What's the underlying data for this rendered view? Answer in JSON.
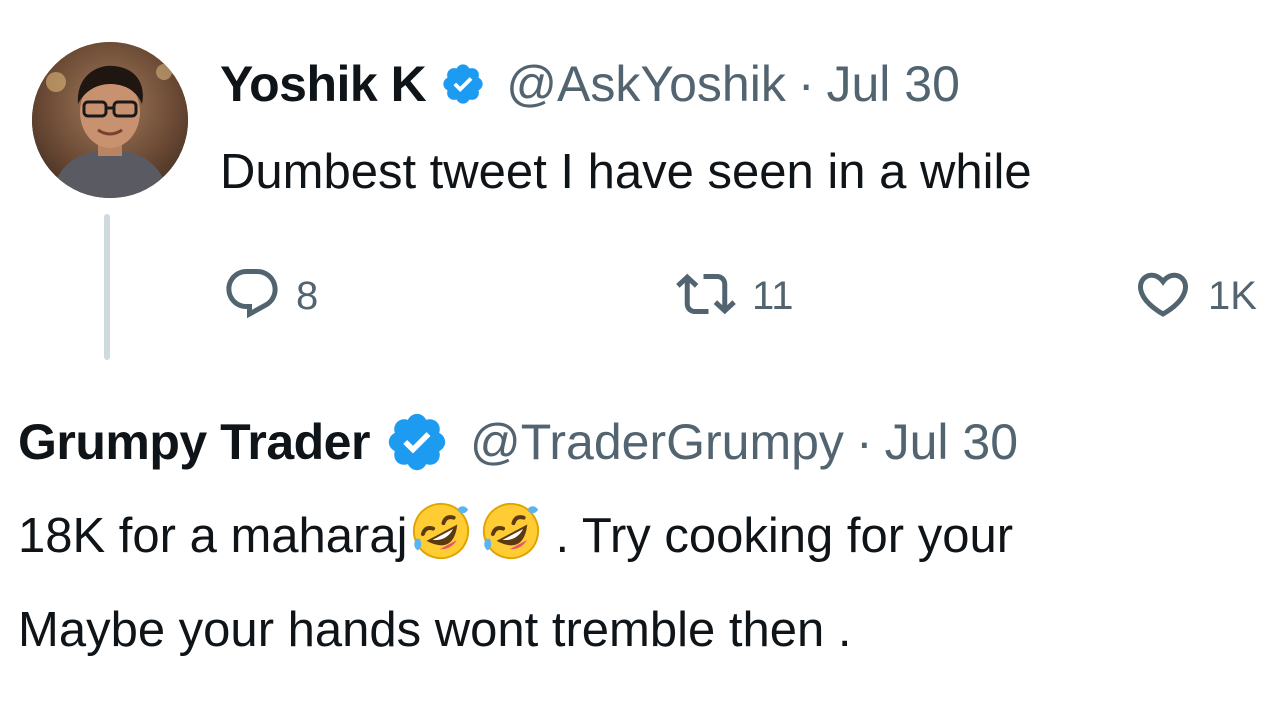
{
  "tweet1": {
    "avatar": "user-avatar-photo",
    "display_name": "Yoshik K",
    "verified": true,
    "handle": "@AskYoshik",
    "separator": "·",
    "date": "Jul 30",
    "text": "Dumbest tweet I have seen in a while",
    "actions": {
      "reply_icon": "reply-icon",
      "reply_count": "8",
      "retweet_icon": "retweet-icon",
      "retweet_count": "11",
      "like_icon": "heart-icon",
      "like_count": "1K"
    }
  },
  "tweet2": {
    "display_name": "Grumpy Trader",
    "verified": true,
    "handle": "@TraderGrumpy",
    "separator": "·",
    "date": "Jul 30",
    "text_line1_before_emoji": "18K for a maharaj",
    "emojis": [
      "rolling-on-floor-laughing-emoji",
      "rolling-on-floor-laughing-emoji"
    ],
    "text_line1_after_emoji": ". Try cooking for your",
    "text_line2": "Maybe your hands wont tremble then ."
  },
  "colors": {
    "text_primary": "#0f1419",
    "text_secondary": "#536471",
    "verified_blue": "#1d9bf0",
    "thread_line": "#cfd9de",
    "background": "#ffffff"
  }
}
